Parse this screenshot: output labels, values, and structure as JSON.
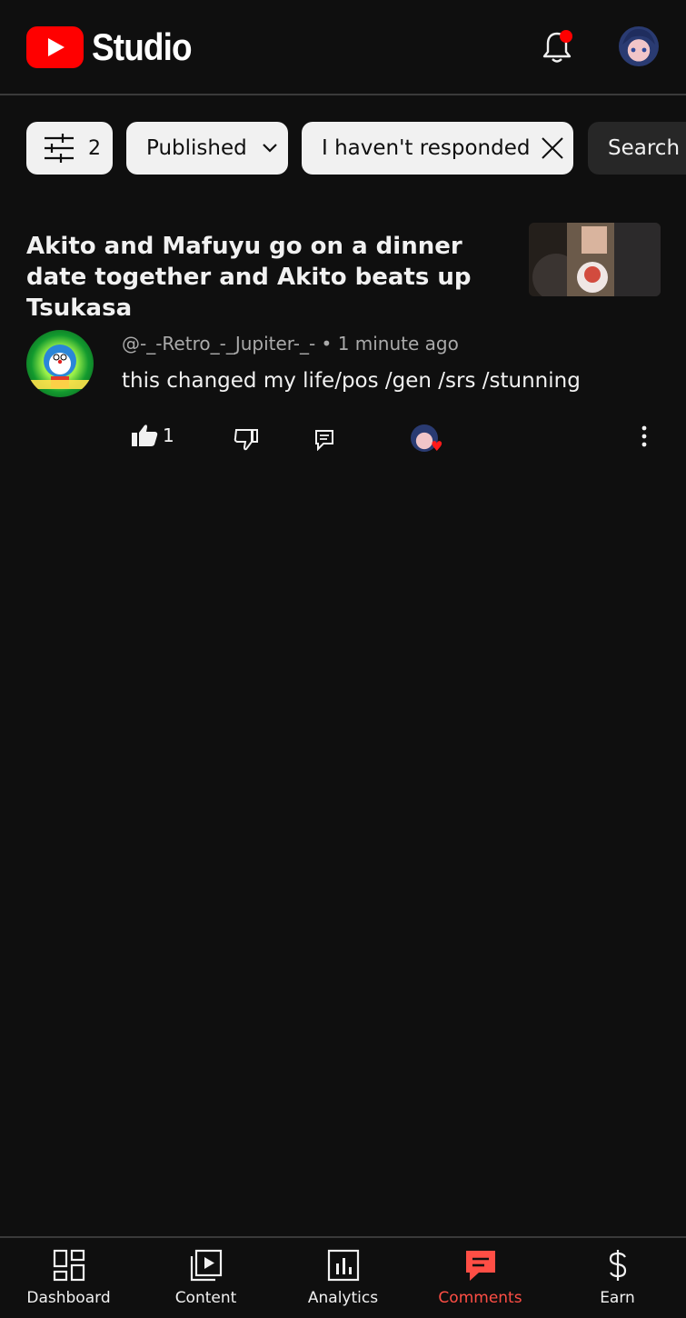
{
  "app": {
    "brand": "Studio"
  },
  "colors": {
    "brand_red": "#ff0000",
    "active_red": "#ff4e45",
    "background": "#0f0f0f"
  },
  "filters": {
    "count": "2",
    "published_label": "Published",
    "responded_label": "I haven't responded",
    "search_label": "Search"
  },
  "video": {
    "title": "Akito and Mafuyu go on a dinner date together and Akito beats up Tsukasa"
  },
  "comment": {
    "author": "@-_-Retro_-_Jupiter-_-",
    "separator": "•",
    "time": "1 minute ago",
    "text": "this changed my life/pos /gen /srs /stunning",
    "likes": "1",
    "hearted": true
  },
  "nav": {
    "items": [
      {
        "label": "Dashboard",
        "icon": "dashboard-icon"
      },
      {
        "label": "Content",
        "icon": "content-icon"
      },
      {
        "label": "Analytics",
        "icon": "analytics-icon"
      },
      {
        "label": "Comments",
        "icon": "comments-icon",
        "active": true
      },
      {
        "label": "Earn",
        "icon": "earn-icon"
      }
    ]
  }
}
